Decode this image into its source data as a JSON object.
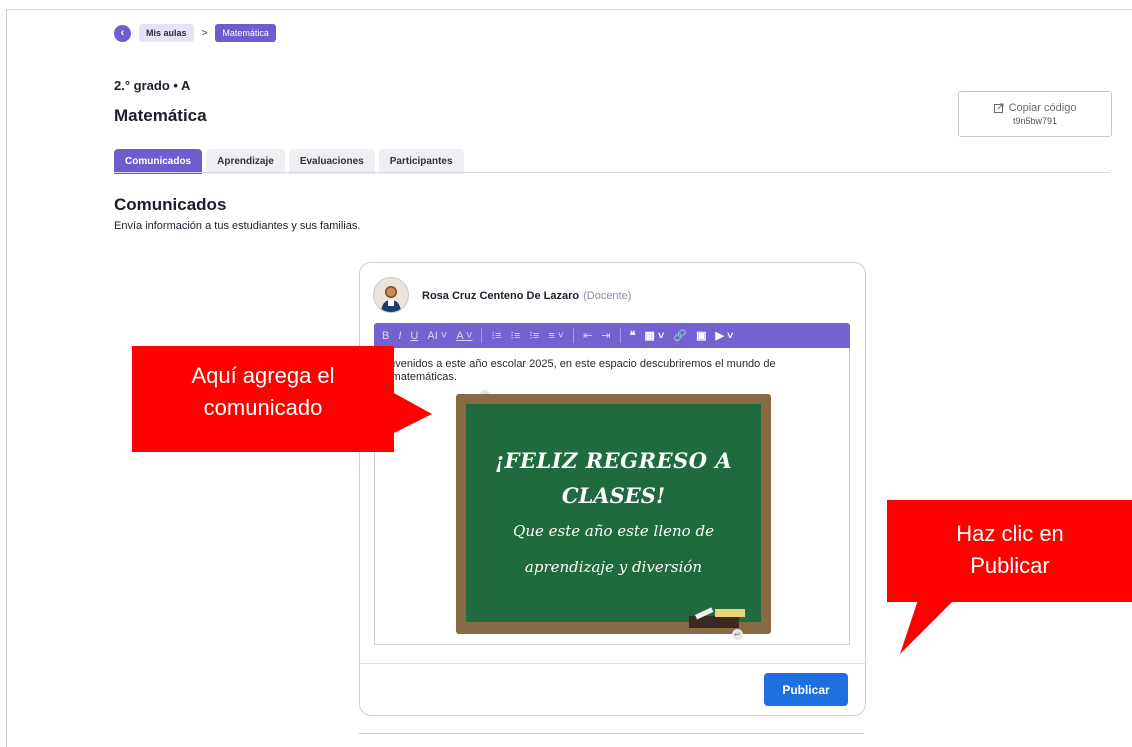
{
  "breadcrumb": {
    "back_icon": "chevron-left-icon",
    "item1": "Mis aulas",
    "separator": ">",
    "item2": "Matemática"
  },
  "header": {
    "grade": "2.° grado • A",
    "title": "Matemática",
    "copy_label": "Copiar código",
    "copy_code": "t9n5bw791",
    "copy_icon": "external-link-icon"
  },
  "tabs": [
    {
      "label": "Comunicados",
      "active": true
    },
    {
      "label": "Aprendizaje",
      "active": false
    },
    {
      "label": "Evaluaciones",
      "active": false
    },
    {
      "label": "Participantes",
      "active": false
    }
  ],
  "section": {
    "title": "Comunicados",
    "subtitle": "Envía información a tus estudiantes y sus familias."
  },
  "post": {
    "author": "Rosa Cruz Centeno De Lazaro",
    "role": "(Docente)",
    "body_text": "envenidos a este año escolar 2025, en este espacio descubriremos el mundo de",
    "body_text_2": "s matemáticas.",
    "image_lines": [
      "¡FELIZ REGRESO A",
      "CLASES!",
      "Que este año este lleno de",
      "aprendizaje y diversión"
    ],
    "publish_label": "Publicar"
  },
  "toolbar": {
    "buttons": [
      "B",
      "I",
      "U",
      "AI ˅",
      "A ˅",
      "⁝≡",
      "⁝≡",
      "⁝≡",
      "≡ ˅",
      "⇤",
      "⇥",
      "❝",
      "▦ ˅",
      "🔗",
      "▣",
      "▶ ˅"
    ]
  },
  "callouts": {
    "left": [
      "Aquí agrega el",
      "comunicado"
    ],
    "right": [
      "Haz clic en",
      "Publicar"
    ]
  },
  "colors": {
    "accent": "#6f5ccf",
    "publish": "#1f6fe0",
    "callout": "#ff0000"
  }
}
